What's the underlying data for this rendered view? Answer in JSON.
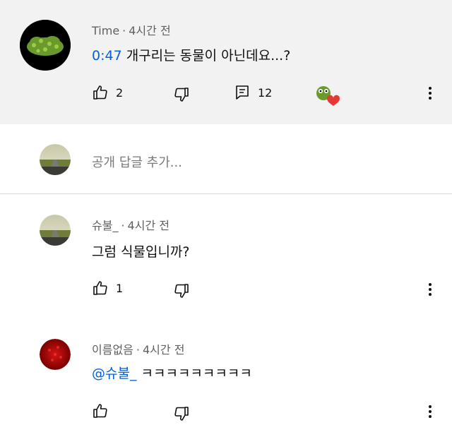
{
  "top_comment": {
    "author": "Time",
    "time": "4시간 전",
    "timestamp_link": "0:47",
    "text": "개구리는 동물이 아닌데요...?",
    "likes": "2",
    "replies": "12"
  },
  "reply_input": {
    "placeholder": "공개 답글 추가..."
  },
  "replies": [
    {
      "author": "슈불_",
      "time": "4시간 전",
      "text": "그럼 식물입니까?",
      "likes": "1"
    },
    {
      "author": "이름없음",
      "time": "4시간 전",
      "mention": "@슈불_",
      "text": "ㅋㅋㅋㅋㅋㅋㅋㅋㅋ",
      "likes": ""
    }
  ],
  "icons": {
    "like": "thumbs-up-icon",
    "dislike": "thumbs-down-icon",
    "reply": "comment-icon",
    "heart": "creator-heart-icon",
    "more": "more-vertical-icon"
  },
  "colors": {
    "link": "#065fd4",
    "highlight_bg": "#f2f2f2",
    "heart": "#e53935"
  }
}
